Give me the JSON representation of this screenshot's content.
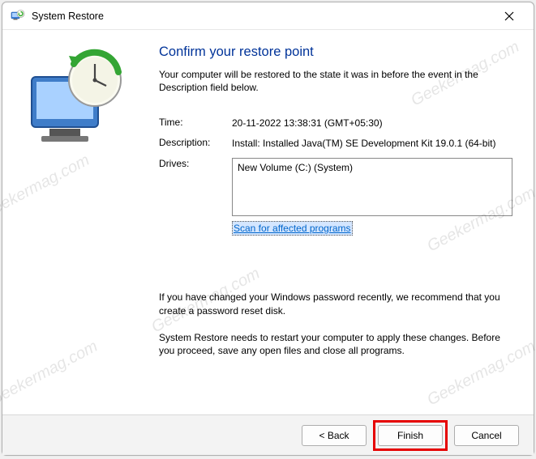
{
  "window": {
    "title": "System Restore"
  },
  "page": {
    "heading": "Confirm your restore point",
    "intro": "Your computer will be restored to the state it was in before the event in the Description field below."
  },
  "fields": {
    "time_label": "Time:",
    "time_value": "20-11-2022 13:38:31 (GMT+05:30)",
    "desc_label": "Description:",
    "desc_value": "Install: Installed Java(TM) SE Development Kit 19.0.1 (64-bit)",
    "drives_label": "Drives:",
    "drives_value": "New Volume (C:) (System)"
  },
  "links": {
    "scan": "Scan for affected programs"
  },
  "notes": {
    "password": "If you have changed your Windows password recently, we recommend that you create a password reset disk.",
    "restart": "System Restore needs to restart your computer to apply these changes. Before you proceed, save any open files and close all programs."
  },
  "buttons": {
    "back": "< Back",
    "finish": "Finish",
    "cancel": "Cancel"
  },
  "watermark": "Geekermag.com"
}
